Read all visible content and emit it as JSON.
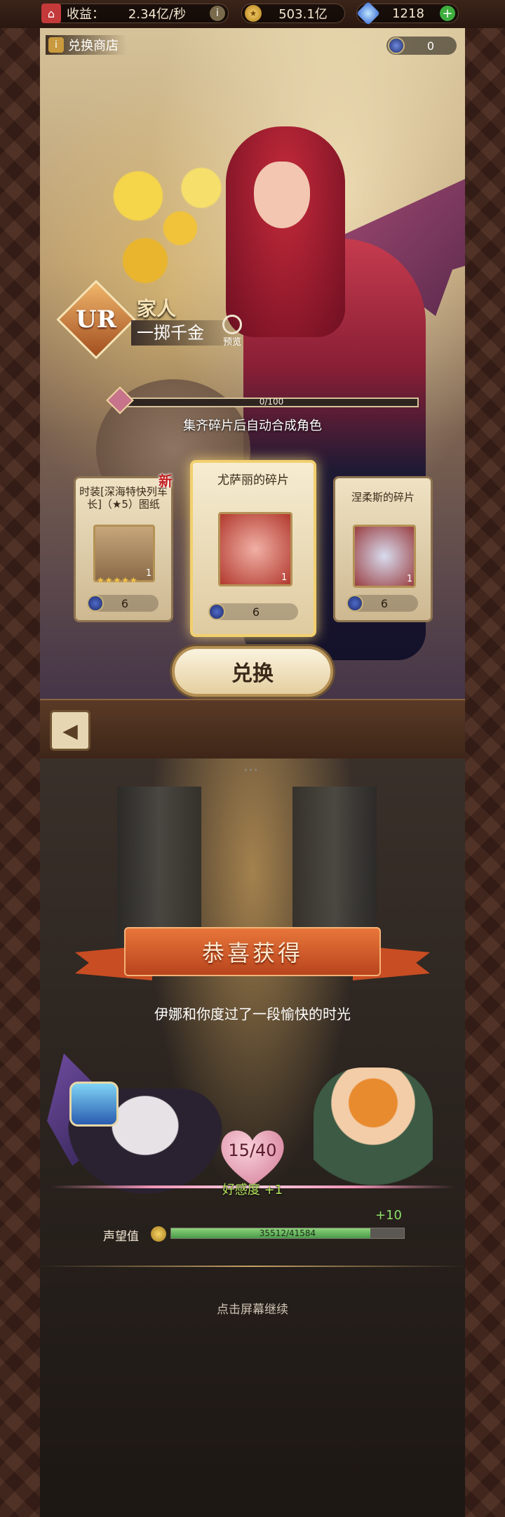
{
  "topbar": {
    "income_label": "收益：",
    "income_value": "2.34亿/秒",
    "gold_value": "503.1亿",
    "gems_value": "1218"
  },
  "shop": {
    "title": "兑换商店",
    "currency_value": "0",
    "rank": "UR",
    "character_name": "家人",
    "character_title": "一掷千金",
    "preview_label": "预览",
    "progress": {
      "current": 0,
      "max": 100,
      "label": "0/100"
    },
    "hint": "集齐碎片后自动合成角色",
    "cards": [
      {
        "name": "时装[深海特快列车长]（★5）图纸",
        "count": "1",
        "cost": "6",
        "badge": "新",
        "stars": "★★★★★"
      },
      {
        "name": "尤萨丽的碎片",
        "count": "1",
        "cost": "6"
      },
      {
        "name": "涅柔斯的碎片",
        "count": "1",
        "cost": "6"
      }
    ],
    "exchange_label": "兑换",
    "back_label": "back"
  },
  "reward": {
    "banner_title": "恭喜获得",
    "message": "伊娜和你度过了一段愉快的时光",
    "affinity_value": "15/40",
    "affinity_label": "好感度",
    "affinity_gain": "+1",
    "reputation_label": "声望值",
    "reputation_value": "35512/41584",
    "reputation_current": 35512,
    "reputation_max": 41584,
    "reputation_gain": "+10",
    "continue_text": "点击屏幕继续"
  },
  "colors": {
    "accent_gold": "#f2d06e",
    "banner_orange": "#e8763a",
    "affinity_green": "#b3e35d",
    "reputation_green": "#4a9a4a"
  }
}
